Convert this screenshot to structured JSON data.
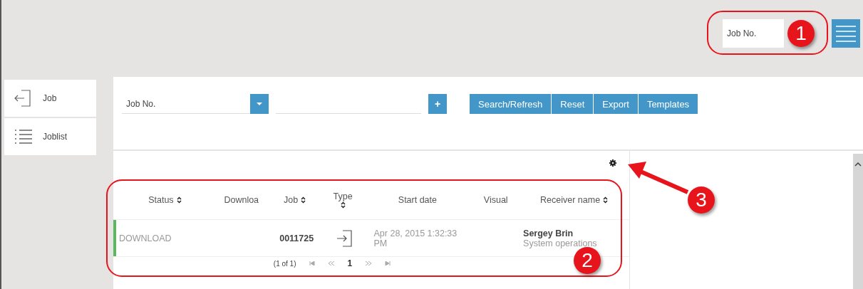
{
  "top_search": {
    "placeholder": "Job No."
  },
  "sidebar": {
    "items": [
      {
        "label": "Job",
        "kind": "enter"
      },
      {
        "label": "Joblist",
        "kind": "list"
      }
    ]
  },
  "filter": {
    "select_value": "Job No.",
    "add_label": "+",
    "buttons": [
      "Search/Refresh",
      "Reset",
      "Export",
      "Templates"
    ]
  },
  "table": {
    "columns": [
      {
        "label": "Status",
        "sortable": true
      },
      {
        "label": "Downloa",
        "sortable": false
      },
      {
        "label": "Job",
        "sortable": true
      },
      {
        "label": "Type",
        "sortable": true
      },
      {
        "label": "Start date",
        "sortable": false
      },
      {
        "label": "Visual",
        "sortable": false
      },
      {
        "label": "Receiver name",
        "sortable": true
      }
    ],
    "rows": [
      {
        "status": "DOWNLOAD",
        "color": "#5cb85c",
        "job": "0011725",
        "start_date": "Apr 28, 2015 1:32:33 PM",
        "receiver_name": "Sergey Brin",
        "receiver_role": "System operations"
      }
    ],
    "pager": {
      "summary": "(1 of 1)",
      "pages": [
        {
          "label": "1",
          "selected": true
        }
      ]
    }
  },
  "annotations": [
    {
      "label": "1"
    },
    {
      "label": "2"
    },
    {
      "label": "3"
    }
  ]
}
